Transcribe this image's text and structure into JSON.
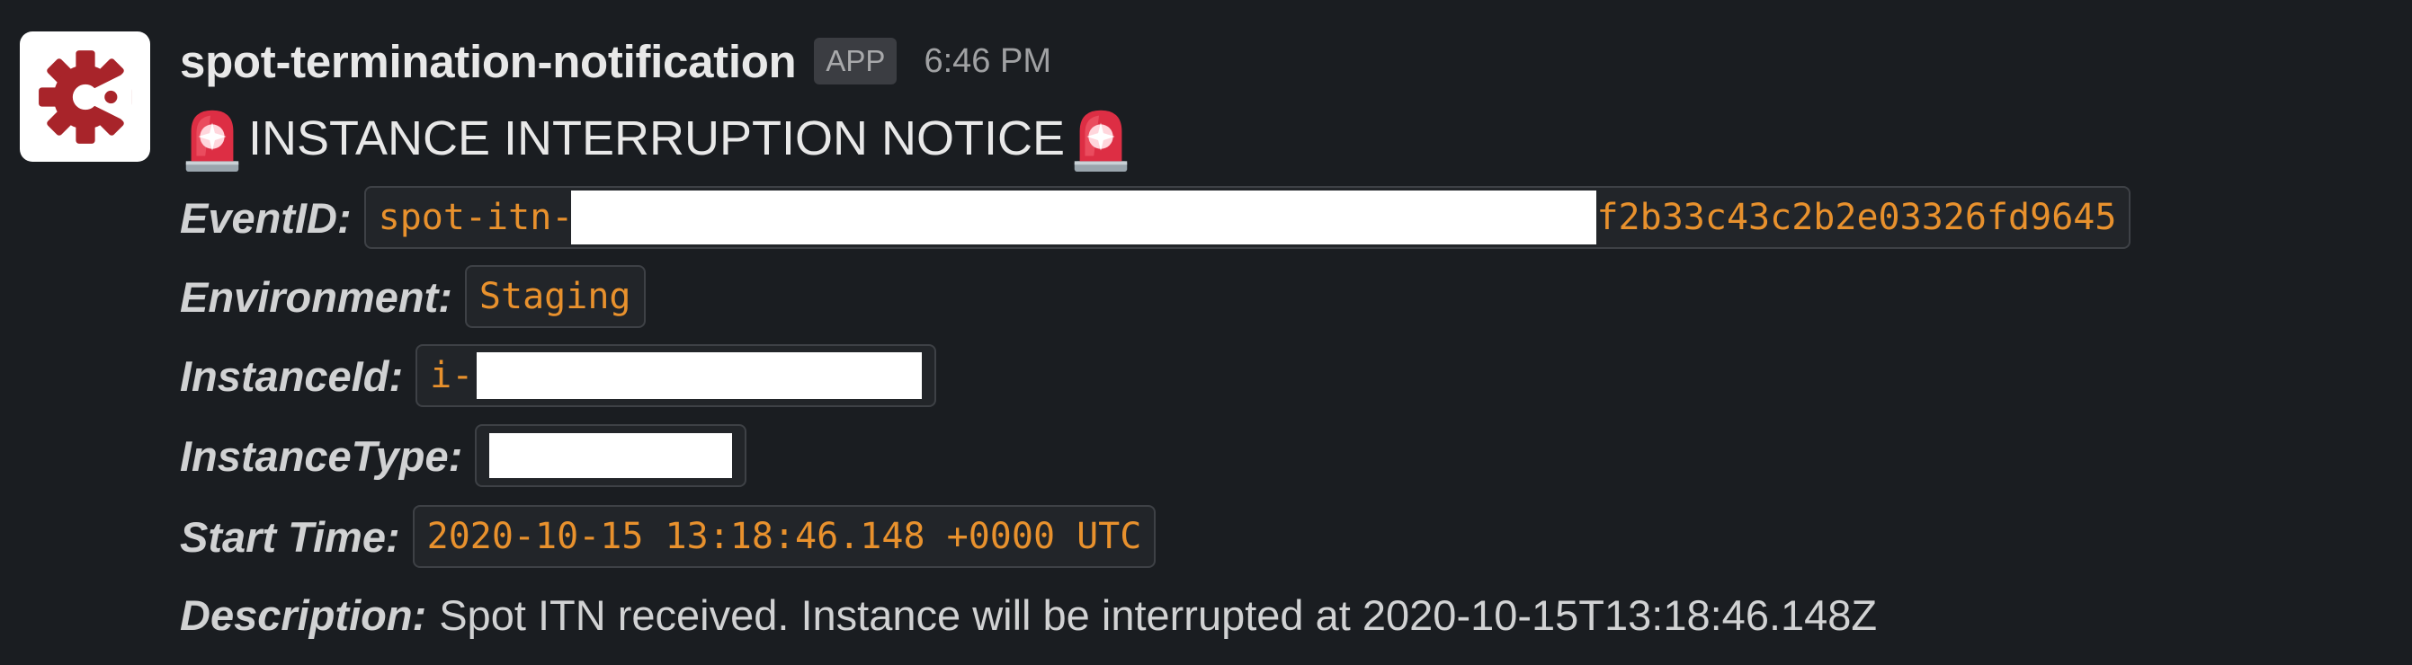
{
  "message": {
    "sender": "spot-termination-notification",
    "badge": "APP",
    "time": "6:46 PM",
    "title": "INSTANCE INTERRUPTION NOTICE",
    "title_icon": "rotating-light-icon",
    "avatar_icon": "gear-logo-icon",
    "colors": {
      "background": "#1a1d21",
      "code_text": "#e8912d",
      "logo": "#a8242a"
    }
  },
  "fields": {
    "event_id": {
      "label": "EventID:",
      "value_prefix": "spot-itn-c",
      "value_suffix": "f2b33c43c2b2e03326fd9645"
    },
    "environment": {
      "label": "Environment:",
      "value": "Staging"
    },
    "instance_id": {
      "label": "InstanceId:",
      "value_prefix": "i-"
    },
    "instance_type": {
      "label": "InstanceType:"
    },
    "start_time": {
      "label": "Start Time:",
      "value": "2020-10-15 13:18:46.148 +0000 UTC"
    },
    "description": {
      "label": "Description:",
      "value": "Spot ITN received. Instance will be interrupted at 2020-10-15T13:18:46.148Z"
    }
  }
}
